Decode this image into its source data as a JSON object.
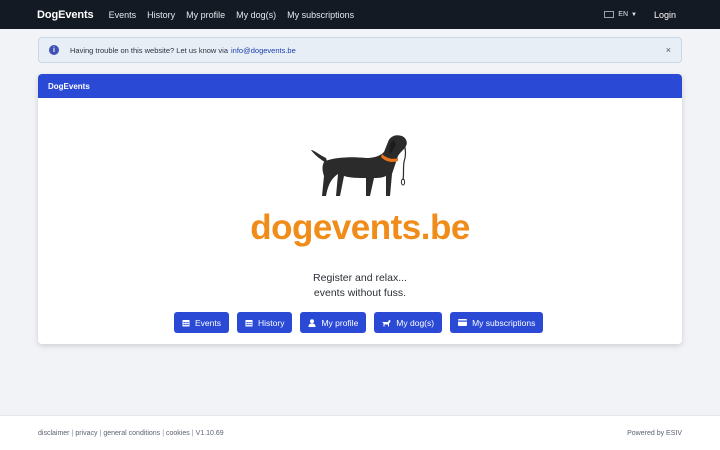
{
  "navbar": {
    "brand": "DogEvents",
    "links": [
      "Events",
      "History",
      "My profile",
      "My dog(s)",
      "My subscriptions"
    ],
    "language": "EN",
    "login": "Login"
  },
  "alert": {
    "text": "Having trouble on this website? Let us know via",
    "link": "info@dogevents.be",
    "close": "×"
  },
  "card": {
    "header": "DogEvents",
    "logo_text": "dogevents.be",
    "tagline_line1": "Register and relax...",
    "tagline_line2": "events without fuss.",
    "buttons": [
      {
        "label": "Events",
        "icon": "calendar-icon"
      },
      {
        "label": "History",
        "icon": "calendar-icon"
      },
      {
        "label": "My profile",
        "icon": "user-icon"
      },
      {
        "label": "My dog(s)",
        "icon": "dog-icon"
      },
      {
        "label": "My subscriptions",
        "icon": "id-card-icon"
      }
    ]
  },
  "footer": {
    "links": [
      "disclaimer",
      "privacy",
      "general conditions",
      "cookies"
    ],
    "version": "V1.10.69",
    "powered": "Powered by ESIV"
  },
  "colors": {
    "navbar": "#141a24",
    "primary": "#2a4ad6",
    "logo_orange": "#f08c19",
    "background": "#f1f3f7"
  }
}
